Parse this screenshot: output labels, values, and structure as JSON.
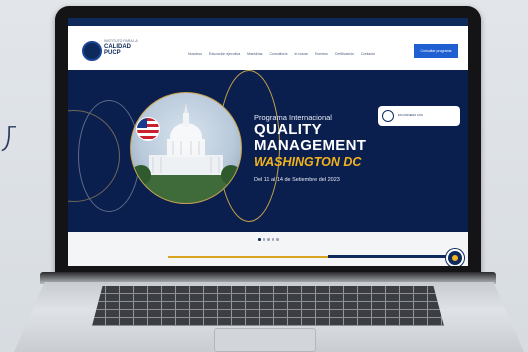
{
  "background_text": "Л",
  "site": {
    "topbar_links": [
      "",
      ""
    ],
    "logo": {
      "line1": "INSTITUTO PARA LA",
      "line2": "CALIDAD",
      "line3": "PUCP"
    },
    "nav": [
      "Nosotros",
      "Educación ejecutiva",
      "Maestrías",
      "Consultoría",
      "In-house",
      "Eventos",
      "Certificación",
      "Contacto"
    ],
    "cta_label": "Consultar programa"
  },
  "hero": {
    "program_label": "Programa Internacional",
    "title_line1": "QUALITY",
    "title_line2": "MANAGEMENT",
    "location": "WASHINGTON DC",
    "dates": "Del 11 al 14 de Setiembre del 2023",
    "badge_text": "EN CONVENIO CON"
  },
  "carousel": {
    "count": 5,
    "active_index": 0
  },
  "colors": {
    "navy": "#0b1f4e",
    "accent_yellow": "#f2b31c",
    "cta_blue": "#1f5fd1"
  }
}
